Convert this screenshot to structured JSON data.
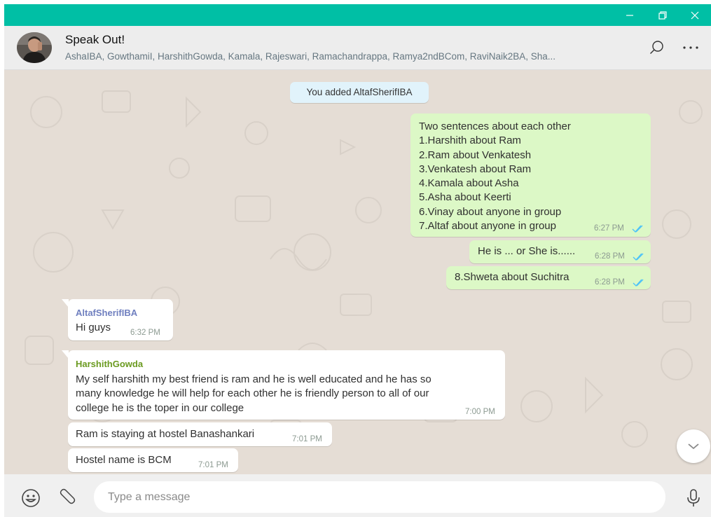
{
  "window": {
    "controls": [
      "minimize",
      "restore",
      "close"
    ]
  },
  "header": {
    "title": "Speak Out!",
    "members": "AshaIBA, GowthamiI, HarshithGowda, Kamala, Rajeswari, Ramachandrappa, Ramya2ndBCom, RaviNaik2BA, Sha...",
    "icons": [
      "search-icon",
      "menu-icon"
    ]
  },
  "messages": {
    "system": "You added AltafSherifIBA",
    "out1": {
      "lines": [
        "Two sentences about each other",
        "1.Harshith about Ram",
        "2.Ram about Venkatesh",
        "3.Venkatesh about Ram",
        "4.Kamala about Asha",
        "5.Asha about Keerti",
        "6.Vinay about anyone in group",
        "7.Altaf about anyone in group"
      ],
      "time": "6:27 PM"
    },
    "out2": {
      "text": "He is ... or She is......",
      "time": "6:28 PM"
    },
    "out3": {
      "text": "8.Shweta about Suchitra",
      "time": "6:28 PM"
    },
    "in1": {
      "sender": "AltafSherifIBA",
      "sender_color": "#6f7fbf",
      "text": "Hi guys",
      "time": "6:32 PM"
    },
    "in2": {
      "sender": "HarshithGowda",
      "sender_color": "#6a9a1f",
      "lines": [
        "My self harshith my best friend  is ram and he is well educated and he has so",
        "many knowledge he  will help for each other he is friendly person to all of our",
        "college he is the toper in our college"
      ],
      "time": "7:00 PM"
    },
    "in3": {
      "text": "Ram is staying at hostel Banashankari",
      "time": "7:01 PM"
    },
    "in4": {
      "text": "Hostel name is BCM",
      "time": "7:01 PM"
    }
  },
  "footer": {
    "placeholder": "Type a message",
    "icons": [
      "emoji-icon",
      "attach-icon",
      "mic-icon"
    ]
  },
  "colors": {
    "titlebar": "#00bfa5",
    "outgoing_bubble": "#dcf8c6",
    "incoming_bubble": "#ffffff",
    "chat_background": "#e5ddd5",
    "read_tick": "#4fc3f7"
  }
}
